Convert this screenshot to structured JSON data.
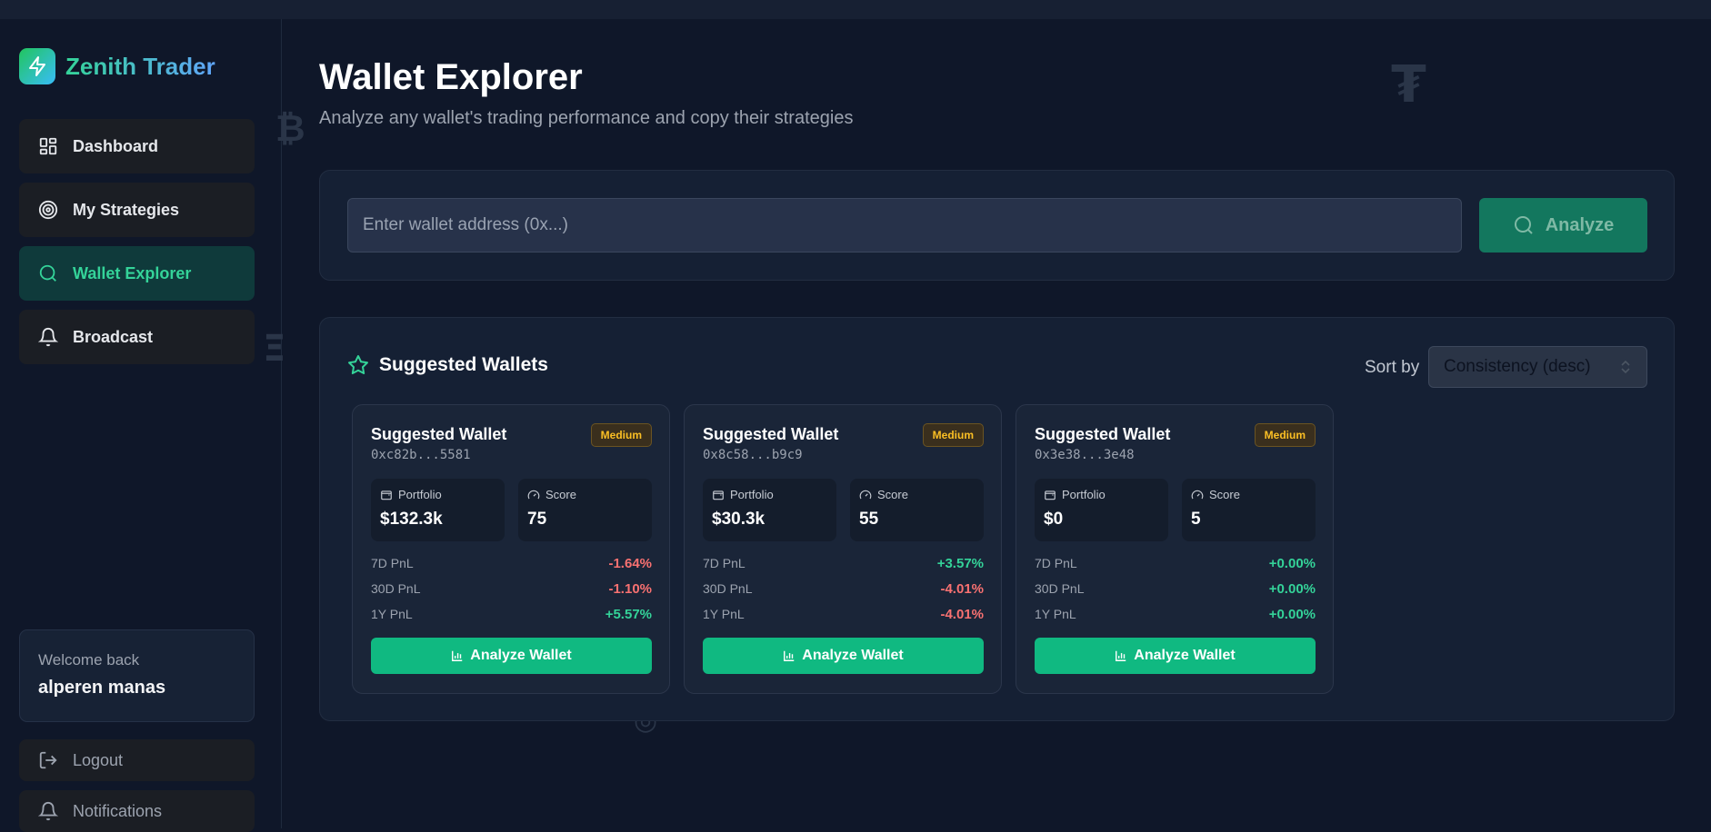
{
  "brand": {
    "name": "Zenith Trader"
  },
  "nav": [
    {
      "label": "Dashboard",
      "icon": "dashboard-icon",
      "active": false
    },
    {
      "label": "My Strategies",
      "icon": "target-icon",
      "active": false
    },
    {
      "label": "Wallet Explorer",
      "icon": "search-icon",
      "active": true
    },
    {
      "label": "Broadcast",
      "icon": "bell-icon",
      "active": false
    }
  ],
  "user": {
    "welcome": "Welcome back",
    "name": "alperen manas"
  },
  "footer_nav": {
    "logout": "Logout",
    "notifications": "Notifications"
  },
  "page": {
    "title": "Wallet Explorer",
    "subtitle": "Analyze any wallet's trading performance and copy their strategies"
  },
  "search": {
    "placeholder": "Enter wallet address (0x...)",
    "value": "",
    "button": "Analyze"
  },
  "suggested": {
    "title": "Suggested Wallets",
    "sort_label": "Sort by",
    "sort_value": "Consistency (desc)",
    "labels": {
      "portfolio": "Portfolio",
      "score": "Score",
      "pnl_7d": "7D PnL",
      "pnl_30d": "30D PnL",
      "pnl_1y": "1Y PnL",
      "analyze": "Analyze Wallet"
    },
    "wallets": [
      {
        "name": "Suggested Wallet",
        "address": "0xc82b...5581",
        "risk": "Medium",
        "portfolio": "$132.3k",
        "score": "75",
        "pnl_7d": "-1.64%",
        "pnl_30d": "-1.10%",
        "pnl_1y": "+5.57%"
      },
      {
        "name": "Suggested Wallet",
        "address": "0x8c58...b9c9",
        "risk": "Medium",
        "portfolio": "$30.3k",
        "score": "55",
        "pnl_7d": "+3.57%",
        "pnl_30d": "-4.01%",
        "pnl_1y": "-4.01%"
      },
      {
        "name": "Suggested Wallet",
        "address": "0x3e38...3e48",
        "risk": "Medium",
        "portfolio": "$0",
        "score": "5",
        "pnl_7d": "+0.00%",
        "pnl_30d": "+0.00%",
        "pnl_1y": "+0.00%"
      }
    ]
  },
  "colors": {
    "accent": "#10b981",
    "positive": "#34d399",
    "negative": "#f87171",
    "badge": "#fbbf24",
    "background": "#0f1729"
  }
}
